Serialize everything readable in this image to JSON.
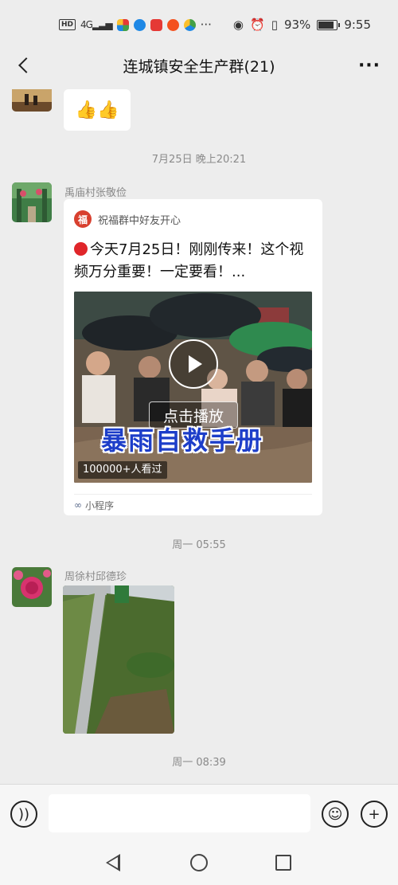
{
  "status_bar": {
    "network_badge": "HD",
    "signal": "4G",
    "left_icons": [
      "app-icon-1",
      "app-icon-2",
      "app-icon-3",
      "app-icon-4",
      "app-icon-5"
    ],
    "more_notifications": "···",
    "battery": "93%",
    "battery_level": 0.93,
    "time": "9:55"
  },
  "header": {
    "title": "连城镇安全生产群(21)",
    "more_label": "···"
  },
  "messages": {
    "m1": {
      "content": "👍👍"
    },
    "ts1": "7月25日 晚上20:21",
    "m2": {
      "sender": "禹庙村张敬俭",
      "card": {
        "source_icon": "福",
        "source": "祝福群中好友开心",
        "title": "今天7月25日！刚刚传来！这个视频万分重要！一定要看！...",
        "play_label": "点击播放",
        "caption": "暴雨自救手册",
        "views": "100000+人看过",
        "footer": "小程序"
      }
    },
    "ts2": "周一 05:55",
    "m3": {
      "sender": "周徐村邱德珍"
    },
    "ts3": "周一 08:39"
  },
  "input_bar": {
    "value": "",
    "placeholder": ""
  },
  "colors": {
    "background": "#ededed",
    "bubble": "#ffffff",
    "timestamp": "#8a8a8a",
    "caption": "#1d3ec9"
  }
}
